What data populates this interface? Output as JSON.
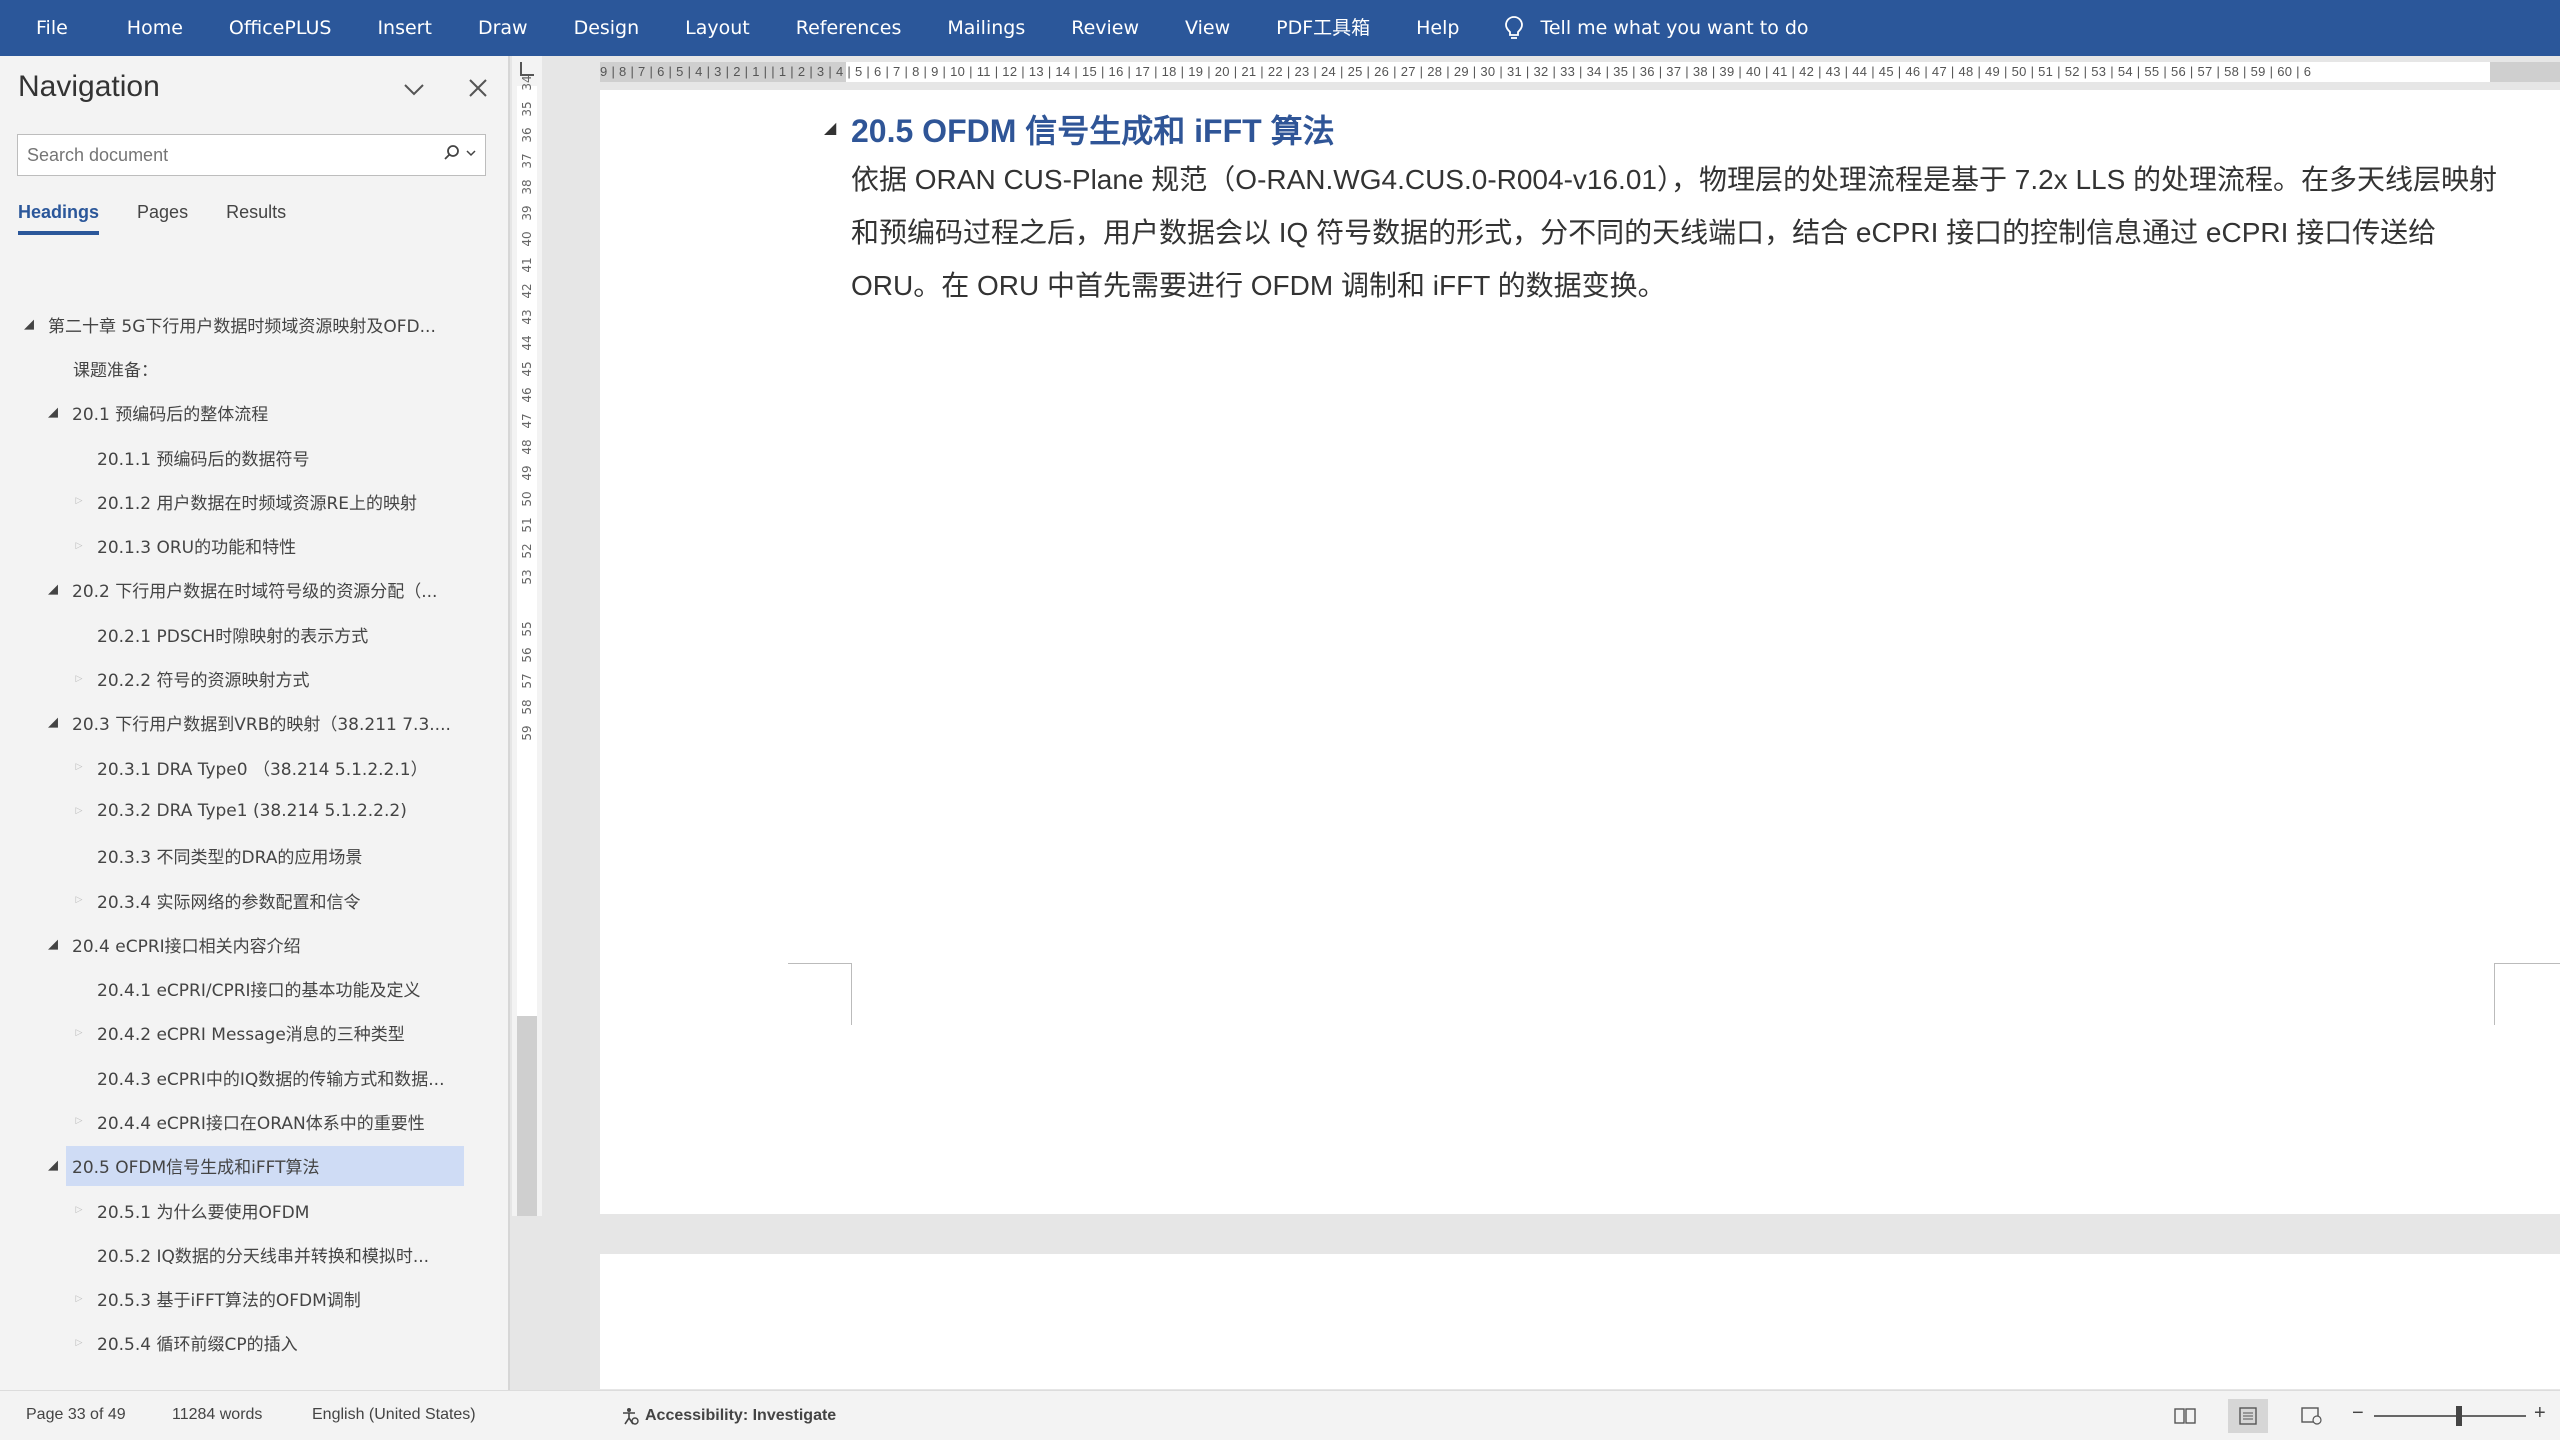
{
  "menu": {
    "items": [
      "File",
      "Home",
      "OfficePLUS",
      "Insert",
      "Draw",
      "Design",
      "Layout",
      "References",
      "Mailings",
      "Review",
      "View",
      "PDF工具箱",
      "Help"
    ],
    "tell_me": "Tell me what you want to do"
  },
  "navigation": {
    "title": "Navigation",
    "search_placeholder": "Search document",
    "tabs": [
      "Headings",
      "Pages",
      "Results"
    ],
    "active_tab": "Headings",
    "headings": [
      {
        "text": "第二十章 5G下行用户数据时频域资源映射及OFD...",
        "level": 1,
        "expanded": true
      },
      {
        "text": "课题准备：",
        "level": 2,
        "expanded": null
      },
      {
        "text": "20.1 预编码后的整体流程",
        "level": 2,
        "expanded": true
      },
      {
        "text": "20.1.1 预编码后的数据符号",
        "level": 3,
        "expanded": null
      },
      {
        "text": "20.1.2 用户数据在时频域资源RE上的映射",
        "level": 3,
        "expanded": false
      },
      {
        "text": "20.1.3 ORU的功能和特性",
        "level": 3,
        "expanded": false
      },
      {
        "text": "20.2 下行用户数据在时域符号级的资源分配（...",
        "level": 2,
        "expanded": true
      },
      {
        "text": "20.2.1 PDSCH时隙映射的表示方式",
        "level": 3,
        "expanded": null
      },
      {
        "text": "20.2.2 符号的资源映射方式",
        "level": 3,
        "expanded": false
      },
      {
        "text": "20.3 下行用户数据到VRB的映射（38.211 7.3....",
        "level": 2,
        "expanded": true
      },
      {
        "text": "20.3.1  DRA Type0 （38.214 5.1.2.2.1）",
        "level": 3,
        "expanded": false
      },
      {
        "text": "20.3.2 DRA Type1 (38.214 5.1.2.2.2)",
        "level": 3,
        "expanded": false
      },
      {
        "text": "20.3.3 不同类型的DRA的应用场景",
        "level": 3,
        "expanded": null
      },
      {
        "text": "20.3.4 实际网络的参数配置和信令",
        "level": 3,
        "expanded": false
      },
      {
        "text": "20.4 eCPRI接口相关内容介绍",
        "level": 2,
        "expanded": true
      },
      {
        "text": "20.4.1 eCPRI/CPRI接口的基本功能及定义",
        "level": 3,
        "expanded": null
      },
      {
        "text": "20.4.2 eCPRI Message消息的三种类型",
        "level": 3,
        "expanded": false
      },
      {
        "text": "20.4.3 eCPRI中的IQ数据的传输方式和数据...",
        "level": 3,
        "expanded": null
      },
      {
        "text": "20.4.4 eCPRI接口在ORAN体系中的重要性",
        "level": 3,
        "expanded": false
      },
      {
        "text": "20.5 OFDM信号生成和iFFT算法",
        "level": 2,
        "expanded": true,
        "selected": true
      },
      {
        "text": "20.5.1 为什么要使用OFDM",
        "level": 3,
        "expanded": false
      },
      {
        "text": "20.5.2 IQ数据的分天线串并转换和模拟时...",
        "level": 3,
        "expanded": null
      },
      {
        "text": "20.5.3 基于iFFT算法的OFDM调制",
        "level": 3,
        "expanded": false
      },
      {
        "text": "20.5.4 循环前缀CP的插入",
        "level": 3,
        "expanded": false
      }
    ]
  },
  "ruler": {
    "horizontal": "9 | 8 | 7 | 6 | 5 | 4 | 3 | 2 | 1 |   | 1 | 2 | 3 | 4 | 5 | 6 | 7 | 8 | 9 | 10 | 11 | 12 | 13 | 14 | 15 | 16 | 17 | 18 | 19 | 20 | 21 | 22 | 23 | 24 | 25 | 26 | 27 | 28 | 29 | 30 | 31 | 32 | 33 | 34 | 35 | 36 | 37 | 38 | 39 | 40 | 41 | 42 | 43 | 44 | 45 | 46 | 47 | 48 | 49 | 50 | 51 | 52 | 53 | 54 | 55 | 56 | 57 | 58 | 59 | 60 | 6",
    "vertical": [
      "34",
      "35",
      "36",
      "37",
      "38",
      "39",
      "40",
      "41",
      "42",
      "43",
      "44",
      "45",
      "46",
      "47",
      "48",
      "49",
      "50",
      "51",
      "52",
      "53",
      "55",
      "56",
      "57",
      "58",
      "59"
    ]
  },
  "document": {
    "heading": "20.5 OFDM 信号生成和 iFFT 算法",
    "body": "依据 ORAN CUS-Plane 规范（O-RAN.WG4.CUS.0-R004-v16.01），物理层的处理流程是基于 7.2x LLS 的处理流程。在多天线层映射和预编码过程之后，用户数据会以 IQ 符号数据的形式，分不同的天线端口，结合 eCPRI 接口的控制信息通过 eCPRI 接口传送给 ORU。在 ORU 中首先需要进行 OFDM 调制和 iFFT 的数据变换。"
  },
  "status": {
    "page": "Page 33 of 49",
    "words": "11284 words",
    "language": "English (United States)",
    "accessibility": "Accessibility: Investigate"
  }
}
